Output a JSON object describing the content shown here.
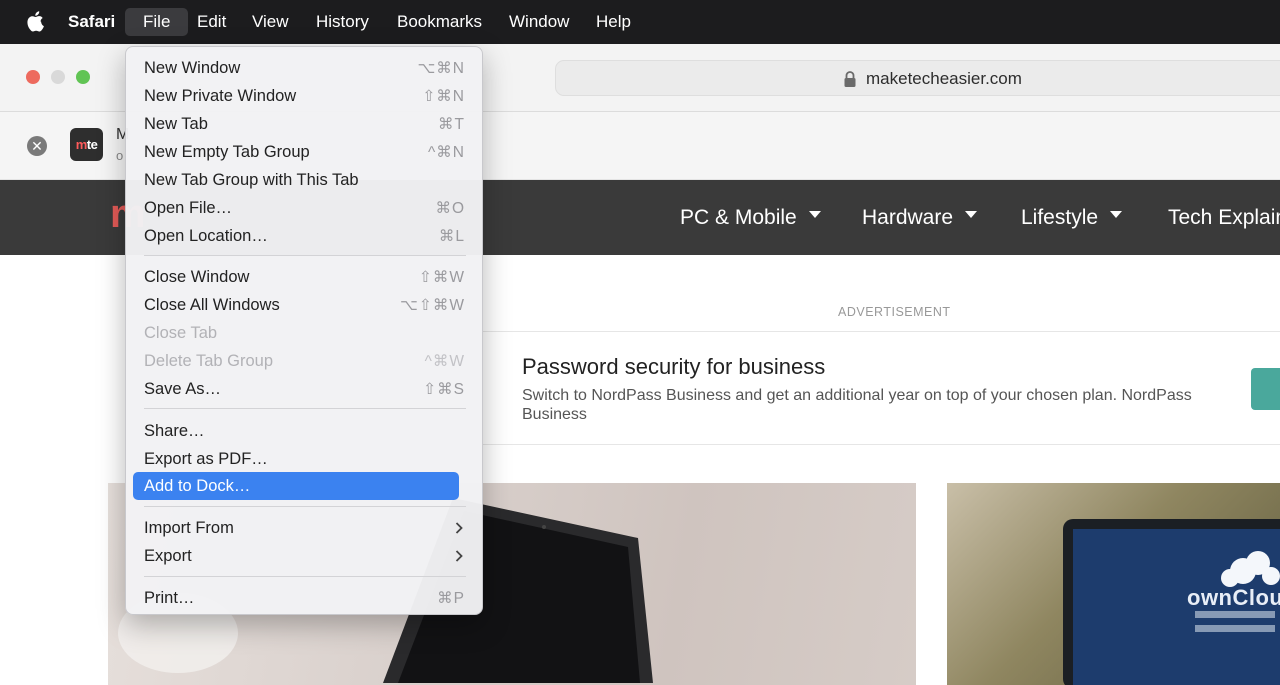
{
  "menubar": {
    "apple_icon": "apple-icon",
    "items": [
      {
        "label": "Safari",
        "name": "menubar-safari"
      },
      {
        "label": "File",
        "name": "menubar-file"
      },
      {
        "label": "Edit",
        "name": "menubar-edit"
      },
      {
        "label": "View",
        "name": "menubar-view"
      },
      {
        "label": "History",
        "name": "menubar-history"
      },
      {
        "label": "Bookmarks",
        "name": "menubar-bookmarks"
      },
      {
        "label": "Window",
        "name": "menubar-window"
      },
      {
        "label": "Help",
        "name": "menubar-help"
      }
    ]
  },
  "toolbar": {
    "url": "maketecheasier.com",
    "lock_icon": "lock-icon",
    "colors": {
      "close": "#ed6a5e",
      "minimize": "#d9d9d9",
      "zoom": "#61c454"
    }
  },
  "banner": {
    "logo_text_m": "m",
    "logo_text_rest": "te",
    "title": "M",
    "subtitle": "o"
  },
  "site": {
    "logo_letter": "m",
    "nav": [
      {
        "label": "PC & Mobile"
      },
      {
        "label": "Hardware"
      },
      {
        "label": "Lifestyle"
      },
      {
        "label": "Tech Explain"
      }
    ]
  },
  "content": {
    "ad_label": "ADVERTISEMENT",
    "ad_title": "Password security for business",
    "ad_body": "Switch to NordPass Business and get an additional year on top of your chosen plan. NordPass Business",
    "photo_right_text": "ownCloud"
  },
  "file_menu": {
    "items": [
      {
        "label": "New Window",
        "shortcut": "⌥⌘N"
      },
      {
        "label": "New Private Window",
        "shortcut": "⇧⌘N"
      },
      {
        "label": "New Tab",
        "shortcut": "⌘T"
      },
      {
        "label": "New Empty Tab Group",
        "shortcut": "^⌘N"
      },
      {
        "label": "New Tab Group with This Tab",
        "shortcut": ""
      },
      {
        "label": "Open File…",
        "shortcut": "⌘O"
      },
      {
        "label": "Open Location…",
        "shortcut": "⌘L"
      },
      {
        "label": "Close Window",
        "shortcut": "⇧⌘W"
      },
      {
        "label": "Close All Windows",
        "shortcut": "⌥⇧⌘W"
      },
      {
        "label": "Close Tab",
        "shortcut": ""
      },
      {
        "label": "Delete Tab Group",
        "shortcut": "^⌘W"
      },
      {
        "label": "Save As…",
        "shortcut": "⇧⌘S"
      },
      {
        "label": "Share…",
        "shortcut": ""
      },
      {
        "label": "Export as PDF…",
        "shortcut": ""
      },
      {
        "label": "Add to Dock…",
        "shortcut": ""
      },
      {
        "label": "Import From",
        "shortcut": ""
      },
      {
        "label": "Export",
        "shortcut": ""
      },
      {
        "label": "Print…",
        "shortcut": "⌘P"
      }
    ],
    "highlight_color": "#3b82f0"
  }
}
